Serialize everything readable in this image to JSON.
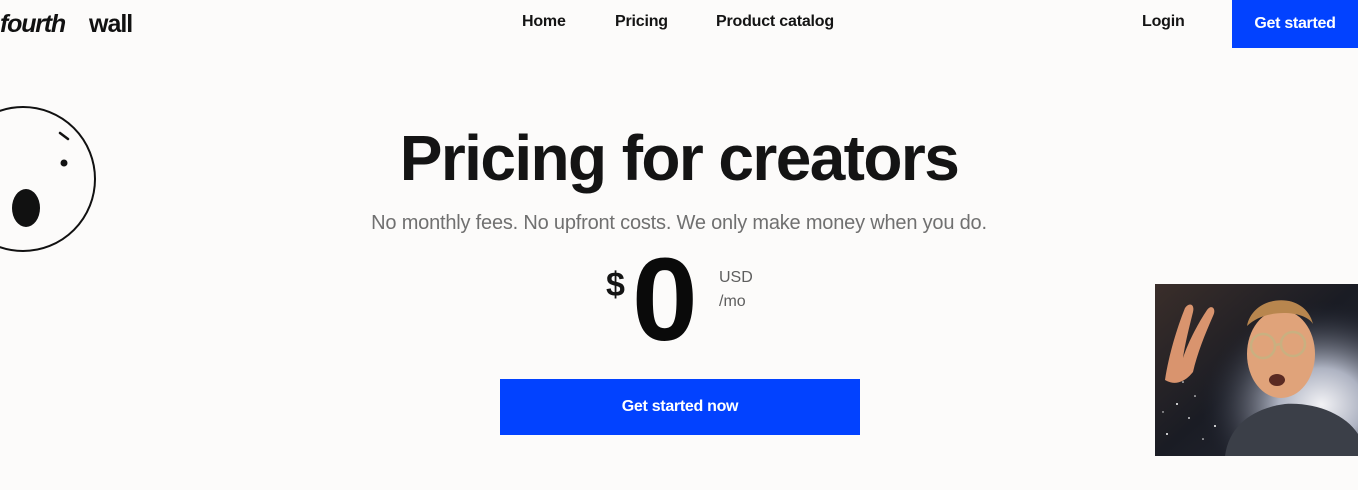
{
  "header": {
    "logo_part1": "fourth",
    "logo_part2": "wall",
    "nav": {
      "home": "Home",
      "pricing": "Pricing",
      "catalog": "Product catalog"
    },
    "login": "Login",
    "cta": "Get started"
  },
  "hero": {
    "title": "Pricing for creators",
    "subtitle": "No monthly fees. No upfront costs. We only make money when you do.",
    "price": {
      "currency_symbol": "$",
      "amount": "0",
      "unit": "USD",
      "period": "/mo"
    },
    "cta": "Get started now"
  },
  "colors": {
    "accent": "#0242ff",
    "background": "#fcfbfa",
    "text": "#141414",
    "muted_text": "#707070"
  },
  "icons": {
    "face": "surprised-face-icon",
    "gif": "animated-gif-thumbnail"
  }
}
